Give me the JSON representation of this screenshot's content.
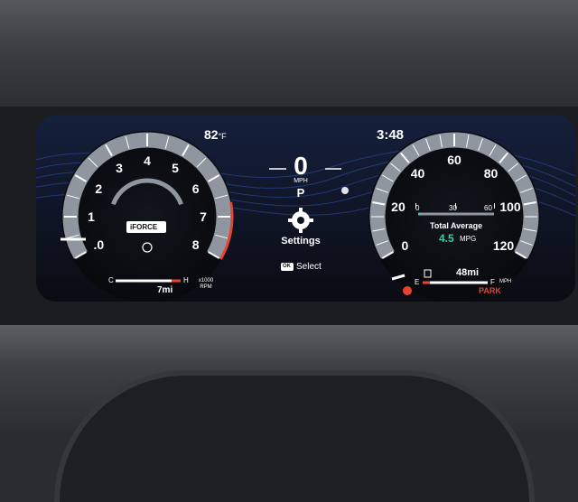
{
  "cluster": {
    "temperature": "82",
    "temperature_unit": "°F",
    "clock": "3:48",
    "speed": {
      "value": "0",
      "unit": "MPH",
      "gear": "P"
    },
    "settings_label": "Settings",
    "select_hint": "Select",
    "select_hint_prefix": "OK",
    "tach": {
      "ticks": [
        ".0",
        "1",
        "2",
        "3",
        "4",
        "5",
        "6",
        "7",
        "8"
      ],
      "unit_line1": "x1000",
      "unit_line2": "RPM",
      "brand": "iFORCE",
      "temp_cold": "C",
      "temp_hot": "H",
      "trip": "7mi",
      "rpm_value": 0
    },
    "speedo": {
      "ticks": [
        "0",
        "20",
        "40",
        "60",
        "80",
        "100",
        "120"
      ],
      "unit": "MPH",
      "mini_scale": [
        "0",
        "30",
        "60"
      ],
      "total_average_label": "Total Average",
      "mpg_value": "4.5",
      "mpg_unit": "MPG",
      "fuel_empty": "E",
      "fuel_full": "F",
      "range": "48mi",
      "park_label": "PARK",
      "speed_value": 0
    },
    "colors": {
      "accent_red": "#e8432e",
      "gauge_grey": "#9aa0a8",
      "screen_bg": "#0c0f18",
      "mpg_green": "#27d3a8",
      "wave_blue": "#3b5fd0"
    }
  }
}
